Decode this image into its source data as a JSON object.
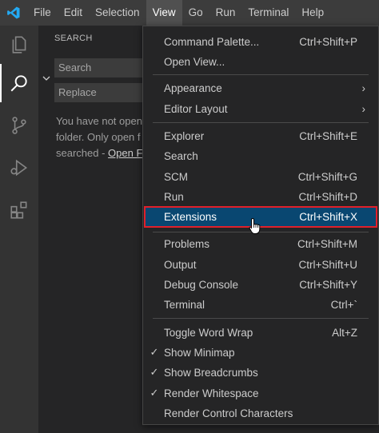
{
  "menubar": {
    "logo": "vscode-logo",
    "items": [
      "File",
      "Edit",
      "Selection",
      "View",
      "Go",
      "Run",
      "Terminal",
      "Help"
    ],
    "active": "View"
  },
  "activitybar": {
    "icons": [
      "explorer-icon",
      "search-icon",
      "source-control-icon",
      "run-debug-icon",
      "extensions-icon"
    ]
  },
  "sidebar": {
    "title": "SEARCH",
    "search_placeholder": "Search",
    "replace_placeholder": "Replace",
    "message_line1": "You have not open",
    "message_line2": "folder. Only open f",
    "message_line3_prefix": "searched - ",
    "message_link": "Open Fo"
  },
  "view_menu": {
    "groups": [
      [
        {
          "label": "Command Palette...",
          "shortcut": "Ctrl+Shift+P"
        },
        {
          "label": "Open View...",
          "shortcut": ""
        }
      ],
      [
        {
          "label": "Appearance",
          "submenu": true
        },
        {
          "label": "Editor Layout",
          "submenu": true
        }
      ],
      [
        {
          "label": "Explorer",
          "shortcut": "Ctrl+Shift+E"
        },
        {
          "label": "Search",
          "shortcut": ""
        },
        {
          "label": "SCM",
          "shortcut": "Ctrl+Shift+G"
        },
        {
          "label": "Run",
          "shortcut": "Ctrl+Shift+D"
        },
        {
          "label": "Extensions",
          "shortcut": "Ctrl+Shift+X",
          "highlighted": true
        }
      ],
      [
        {
          "label": "Problems",
          "shortcut": "Ctrl+Shift+M"
        },
        {
          "label": "Output",
          "shortcut": "Ctrl+Shift+U"
        },
        {
          "label": "Debug Console",
          "shortcut": "Ctrl+Shift+Y"
        },
        {
          "label": "Terminal",
          "shortcut": "Ctrl+`"
        }
      ],
      [
        {
          "label": "Toggle Word Wrap",
          "shortcut": "Alt+Z"
        },
        {
          "label": "Show Minimap",
          "checked": true
        },
        {
          "label": "Show Breadcrumbs",
          "checked": true
        },
        {
          "label": "Render Whitespace",
          "checked": true
        },
        {
          "label": "Render Control Characters"
        }
      ]
    ],
    "check_glyph": "✓",
    "submenu_glyph": "›"
  },
  "colors": {
    "highlight_bg": "#094771",
    "highlight_border": "#e0202a",
    "accent": "#0078d4"
  }
}
